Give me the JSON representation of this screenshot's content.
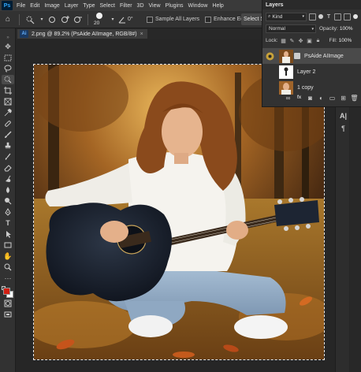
{
  "menubar": {
    "logo": "Ps",
    "items": [
      "File",
      "Edit",
      "Image",
      "Layer",
      "Type",
      "Select",
      "Filter",
      "3D",
      "View",
      "Plugins",
      "Window",
      "Help"
    ]
  },
  "options": {
    "brush_size": "20",
    "angle": "0°",
    "sample_all_layers": "Sample All Layers",
    "enhance_edge": "Enhance Edge",
    "select_subject": "Select Su"
  },
  "document": {
    "tab_title": "2.png @ 89.2% (PsAide AIImage, RGB/8#)",
    "close": "×"
  },
  "layers": {
    "title": "Layers",
    "kind": "Kind",
    "blend_mode": "Normal",
    "opacity_label": "Opacity:",
    "opacity_value": "100%",
    "lock_label": "Lock:",
    "fill_label": "Fill:",
    "fill_value": "100%",
    "items": [
      {
        "name": "PsAide AIImage",
        "selected": true
      },
      {
        "name": "Layer 2",
        "selected": false
      },
      {
        "name": "1 copy",
        "selected": false
      }
    ]
  },
  "dock": {
    "para_icon": "¶",
    "text_icon": "A|"
  },
  "colors": {
    "foreground": "#d21f12",
    "background": "#ffffff",
    "accent": "#31a8ff"
  }
}
